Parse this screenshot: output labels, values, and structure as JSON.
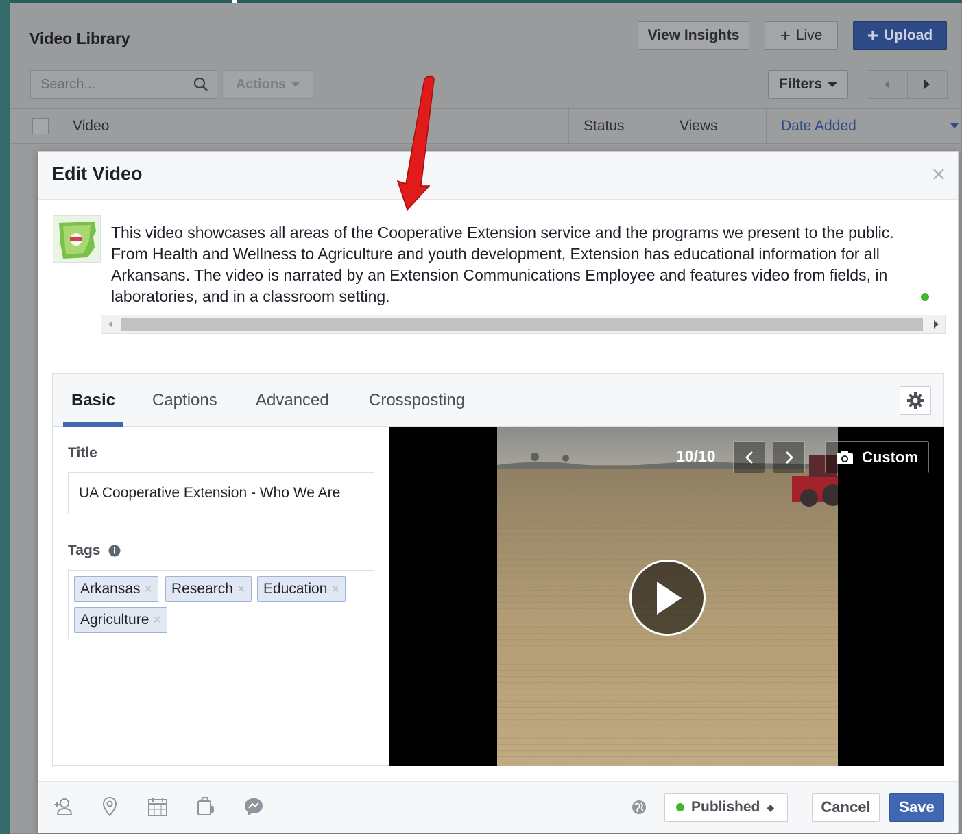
{
  "library": {
    "title": "Video Library",
    "buttons": {
      "insights": "View Insights",
      "live": "Live",
      "upload": "Upload"
    },
    "search": {
      "placeholder": "Search..."
    },
    "actions_label": "Actions",
    "filters_label": "Filters",
    "columns": [
      "Video",
      "Status",
      "Views",
      "Date Added"
    ],
    "sort_active": "Date Added"
  },
  "modal": {
    "title": "Edit Video",
    "description": "This video showcases all areas of the Cooperative Extension service and the programs we present to the public. From Health and Wellness to Agriculture and youth development, Extension has educational information for all Arkansans. The video is narrated by an Extension Communications Employee and features video from fields, in laboratories, and in a classroom setting.",
    "tabs": [
      {
        "label": "Basic",
        "active": true
      },
      {
        "label": "Captions",
        "active": false
      },
      {
        "label": "Advanced",
        "active": false
      },
      {
        "label": "Crossposting",
        "active": false
      }
    ],
    "form": {
      "title_label": "Title",
      "title_value": "UA Cooperative Extension - Who We Are",
      "tags_label": "Tags",
      "tags": [
        "Arkansas",
        "Research",
        "Education",
        "Agriculture"
      ],
      "tag_remove_glyph": "×"
    },
    "player": {
      "thumbnail_counter": "10/10",
      "custom_label": "Custom"
    },
    "footer": {
      "privacy": "Published",
      "cancel": "Cancel",
      "save": "Save"
    }
  },
  "icons": {
    "footer": [
      "tag-people-icon",
      "location-icon",
      "calendar-icon",
      "feeling-icon",
      "messenger-icon"
    ],
    "privacy": "globe-icon"
  },
  "colors": {
    "accent": "#4267b2",
    "status_green": "#42b72a",
    "annotation_arrow": "#e11b1b"
  }
}
